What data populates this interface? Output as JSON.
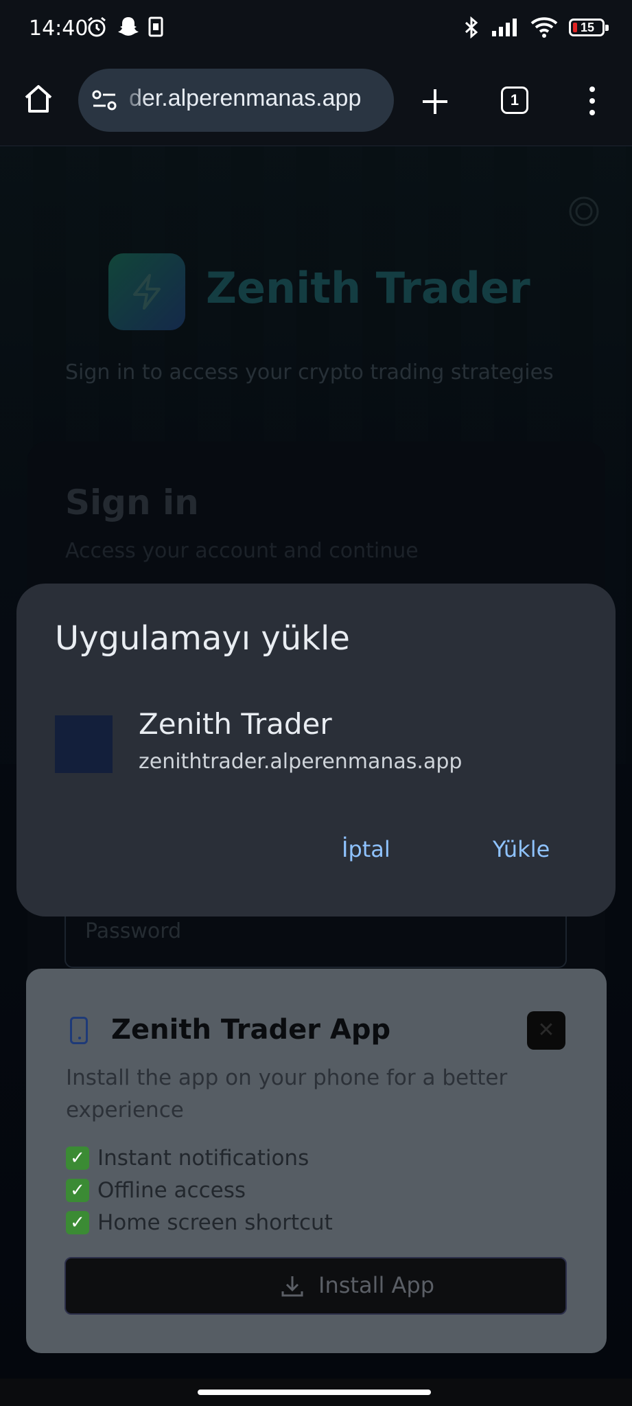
{
  "status_bar": {
    "time": "14:40",
    "battery": "15"
  },
  "browser": {
    "url": "der.alperenmanas.app",
    "tab_count": "1"
  },
  "page": {
    "brand": "Zenith Trader",
    "tagline": "Sign in to access your crypto trading strategies",
    "signin_title": "Sign in",
    "signin_subtitle": "Access your account and continue",
    "password_placeholder": "Password"
  },
  "install_banner": {
    "title": "Zenith Trader App",
    "description": "Install the app on your phone for a better experience",
    "features": [
      "Instant notifications",
      "Offline access",
      "Home screen shortcut"
    ],
    "install_button": "Install App",
    "close_label": "✕"
  },
  "dialog": {
    "title": "Uygulamayı yükle",
    "app_name": "Zenith Trader",
    "app_url": "zenithtrader.alperenmanas.app",
    "cancel": "İptal",
    "install": "Yükle"
  },
  "colors": {
    "accent": "#8fc3ff",
    "dialog_bg": "#2a2f38",
    "brand_teal": "#1d6b58"
  },
  "icons": [
    "alarm-icon",
    "snapchat-icon",
    "sim-icon",
    "bluetooth-icon",
    "signal-icon",
    "wifi-icon",
    "battery-icon",
    "home-icon",
    "site-settings-icon",
    "plus-icon",
    "tabs-icon",
    "overflow-menu-icon",
    "bolt-icon",
    "phone-icon",
    "close-icon",
    "check-icon",
    "download-icon"
  ]
}
